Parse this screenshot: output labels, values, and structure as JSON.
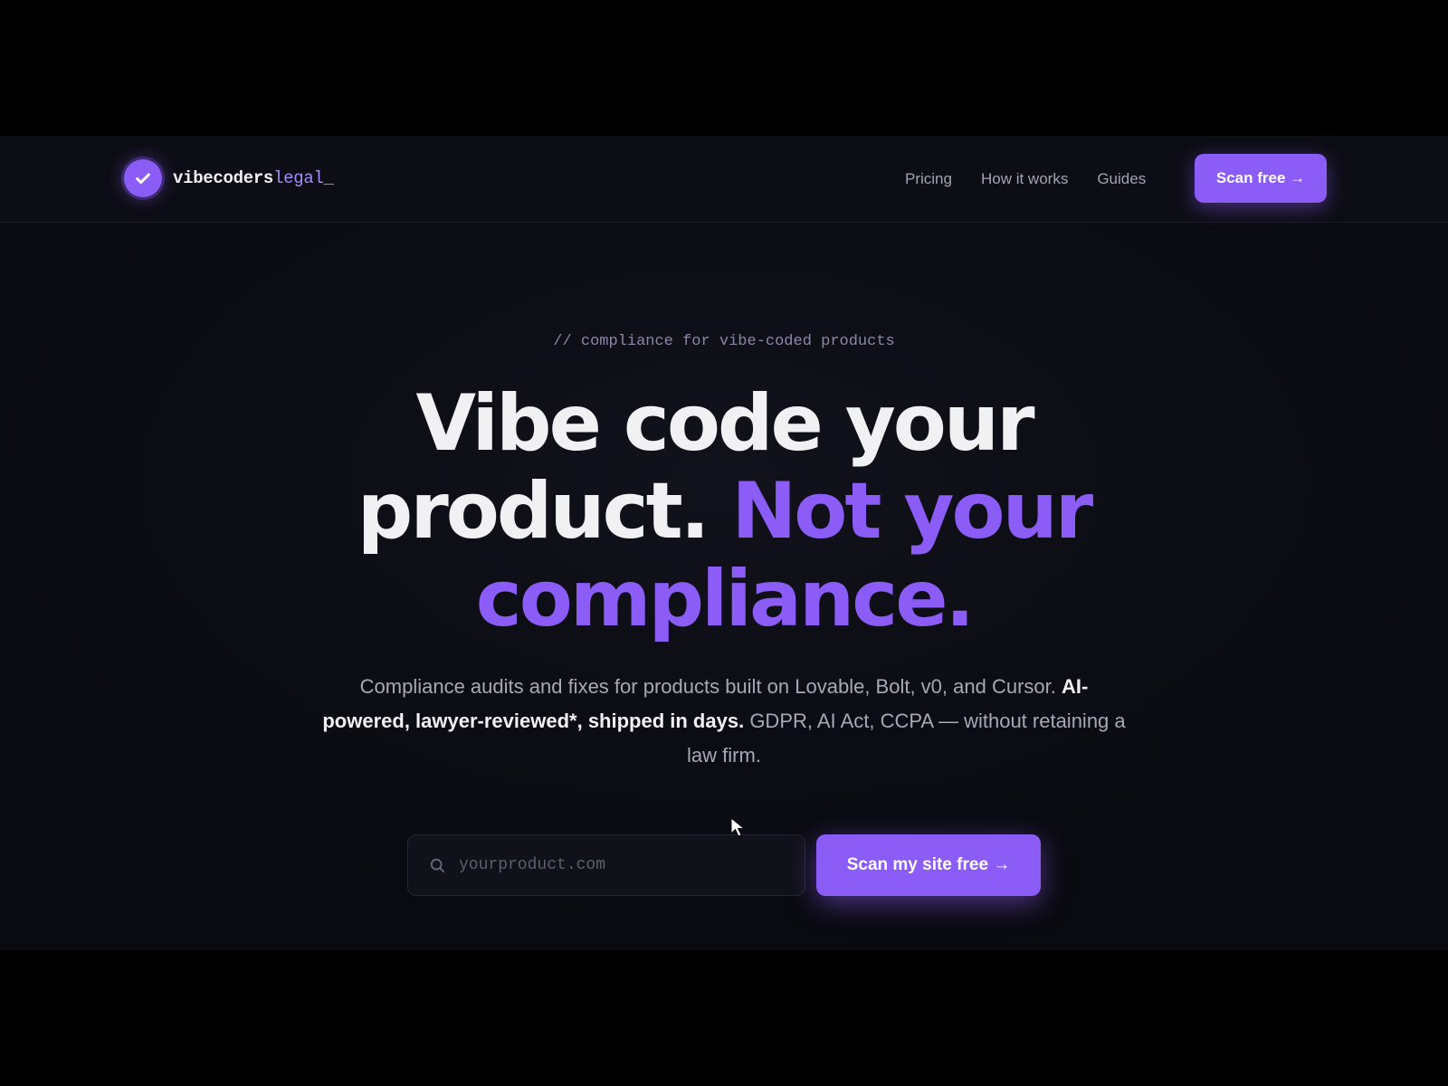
{
  "brand": {
    "name_part1": "vibecoders",
    "name_part2": "legal",
    "name_part3": "_",
    "logo_icon": "check-circle-icon"
  },
  "nav": {
    "links": [
      "Pricing",
      "How it works",
      "Guides"
    ],
    "cta_label": "Scan free →"
  },
  "hero": {
    "eyebrow": "// compliance for vibe-coded products",
    "headline_line1": "Vibe code your",
    "headline_line2_plain": "product.",
    "headline_line2_accent": "Not your",
    "headline_line3_accent": "compliance.",
    "sub_part1": "Compliance audits and fixes for products built on Lovable, Bolt, v0, and Cursor.",
    "sub_bold": "AI-powered, lawyer-reviewed*, shipped in days.",
    "sub_part2": "GDPR, AI Act, CCPA — without retaining a law firm."
  },
  "scan": {
    "placeholder": "yourproduct.com",
    "button_label": "Scan my site free →",
    "input_icon": "search-icon"
  },
  "colors": {
    "accent": "#8b5cf6",
    "accent_light": "#a78bfa",
    "background": "#0c0c14",
    "text": "#f1f1f3",
    "muted": "#a8a8b6"
  }
}
